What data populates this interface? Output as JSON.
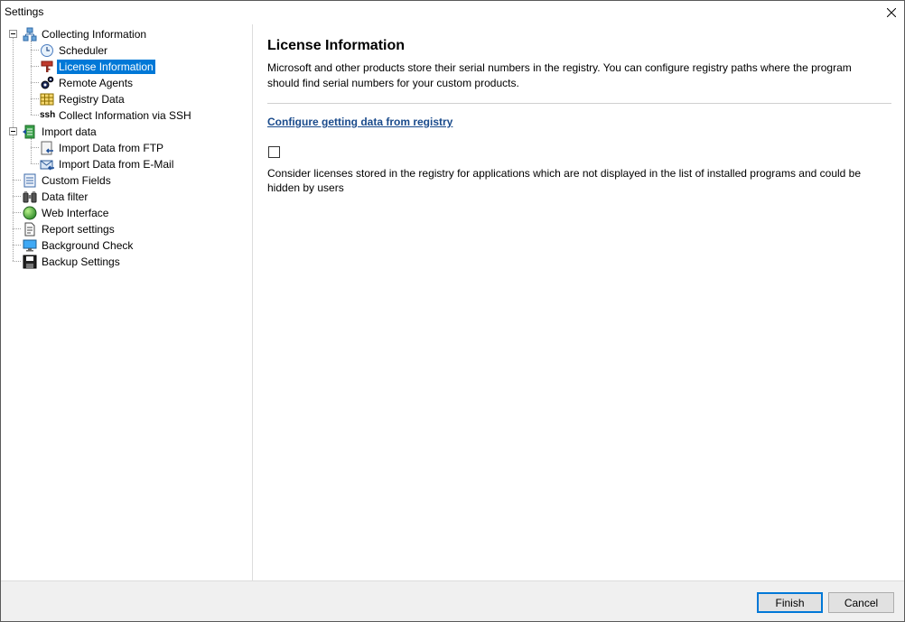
{
  "window": {
    "title": "Settings"
  },
  "tree": {
    "collecting": {
      "label": "Collecting Information",
      "icon": "network-icon"
    },
    "scheduler": {
      "label": "Scheduler",
      "icon": "clock-icon"
    },
    "license": {
      "label": "License Information",
      "icon": "key-icon",
      "selected": true
    },
    "remote_agents": {
      "label": "Remote Agents",
      "icon": "gears-icon"
    },
    "registry_data": {
      "label": "Registry Data",
      "icon": "grid-icon"
    },
    "ssh": {
      "label": "Collect Information via SSH",
      "icon_text": "ssh"
    },
    "import_data": {
      "label": "Import data",
      "icon": "import-icon"
    },
    "import_ftp": {
      "label": "Import Data from FTP",
      "icon": "ftp-import-icon"
    },
    "import_email": {
      "label": "Import Data from E-Mail",
      "icon": "email-import-icon"
    },
    "custom_fields": {
      "label": "Custom Fields",
      "icon": "list-icon"
    },
    "data_filter": {
      "label": "Data filter",
      "icon": "binoculars-icon"
    },
    "web_interface": {
      "label": "Web Interface",
      "icon": "globe-icon"
    },
    "report_settings": {
      "label": "Report settings",
      "icon": "report-icon"
    },
    "background_check": {
      "label": "Background Check",
      "icon": "monitor-icon"
    },
    "backup_settings": {
      "label": "Backup Settings",
      "icon": "floppy-icon"
    }
  },
  "content": {
    "title": "License Information",
    "description": "Microsoft and other products store their serial numbers in the registry. You can configure registry paths where the program should find serial numbers for your custom products.",
    "link": "Configure getting data from registry",
    "checkbox_checked": false,
    "checkbox_label": "Consider licenses stored in the registry for applications which are not displayed in the list of installed programs and could be hidden by users"
  },
  "footer": {
    "finish": "Finish",
    "cancel": "Cancel"
  },
  "colors": {
    "selection": "#0078d7",
    "link": "#1a4b8c",
    "footer_bg": "#f0f0f0"
  }
}
